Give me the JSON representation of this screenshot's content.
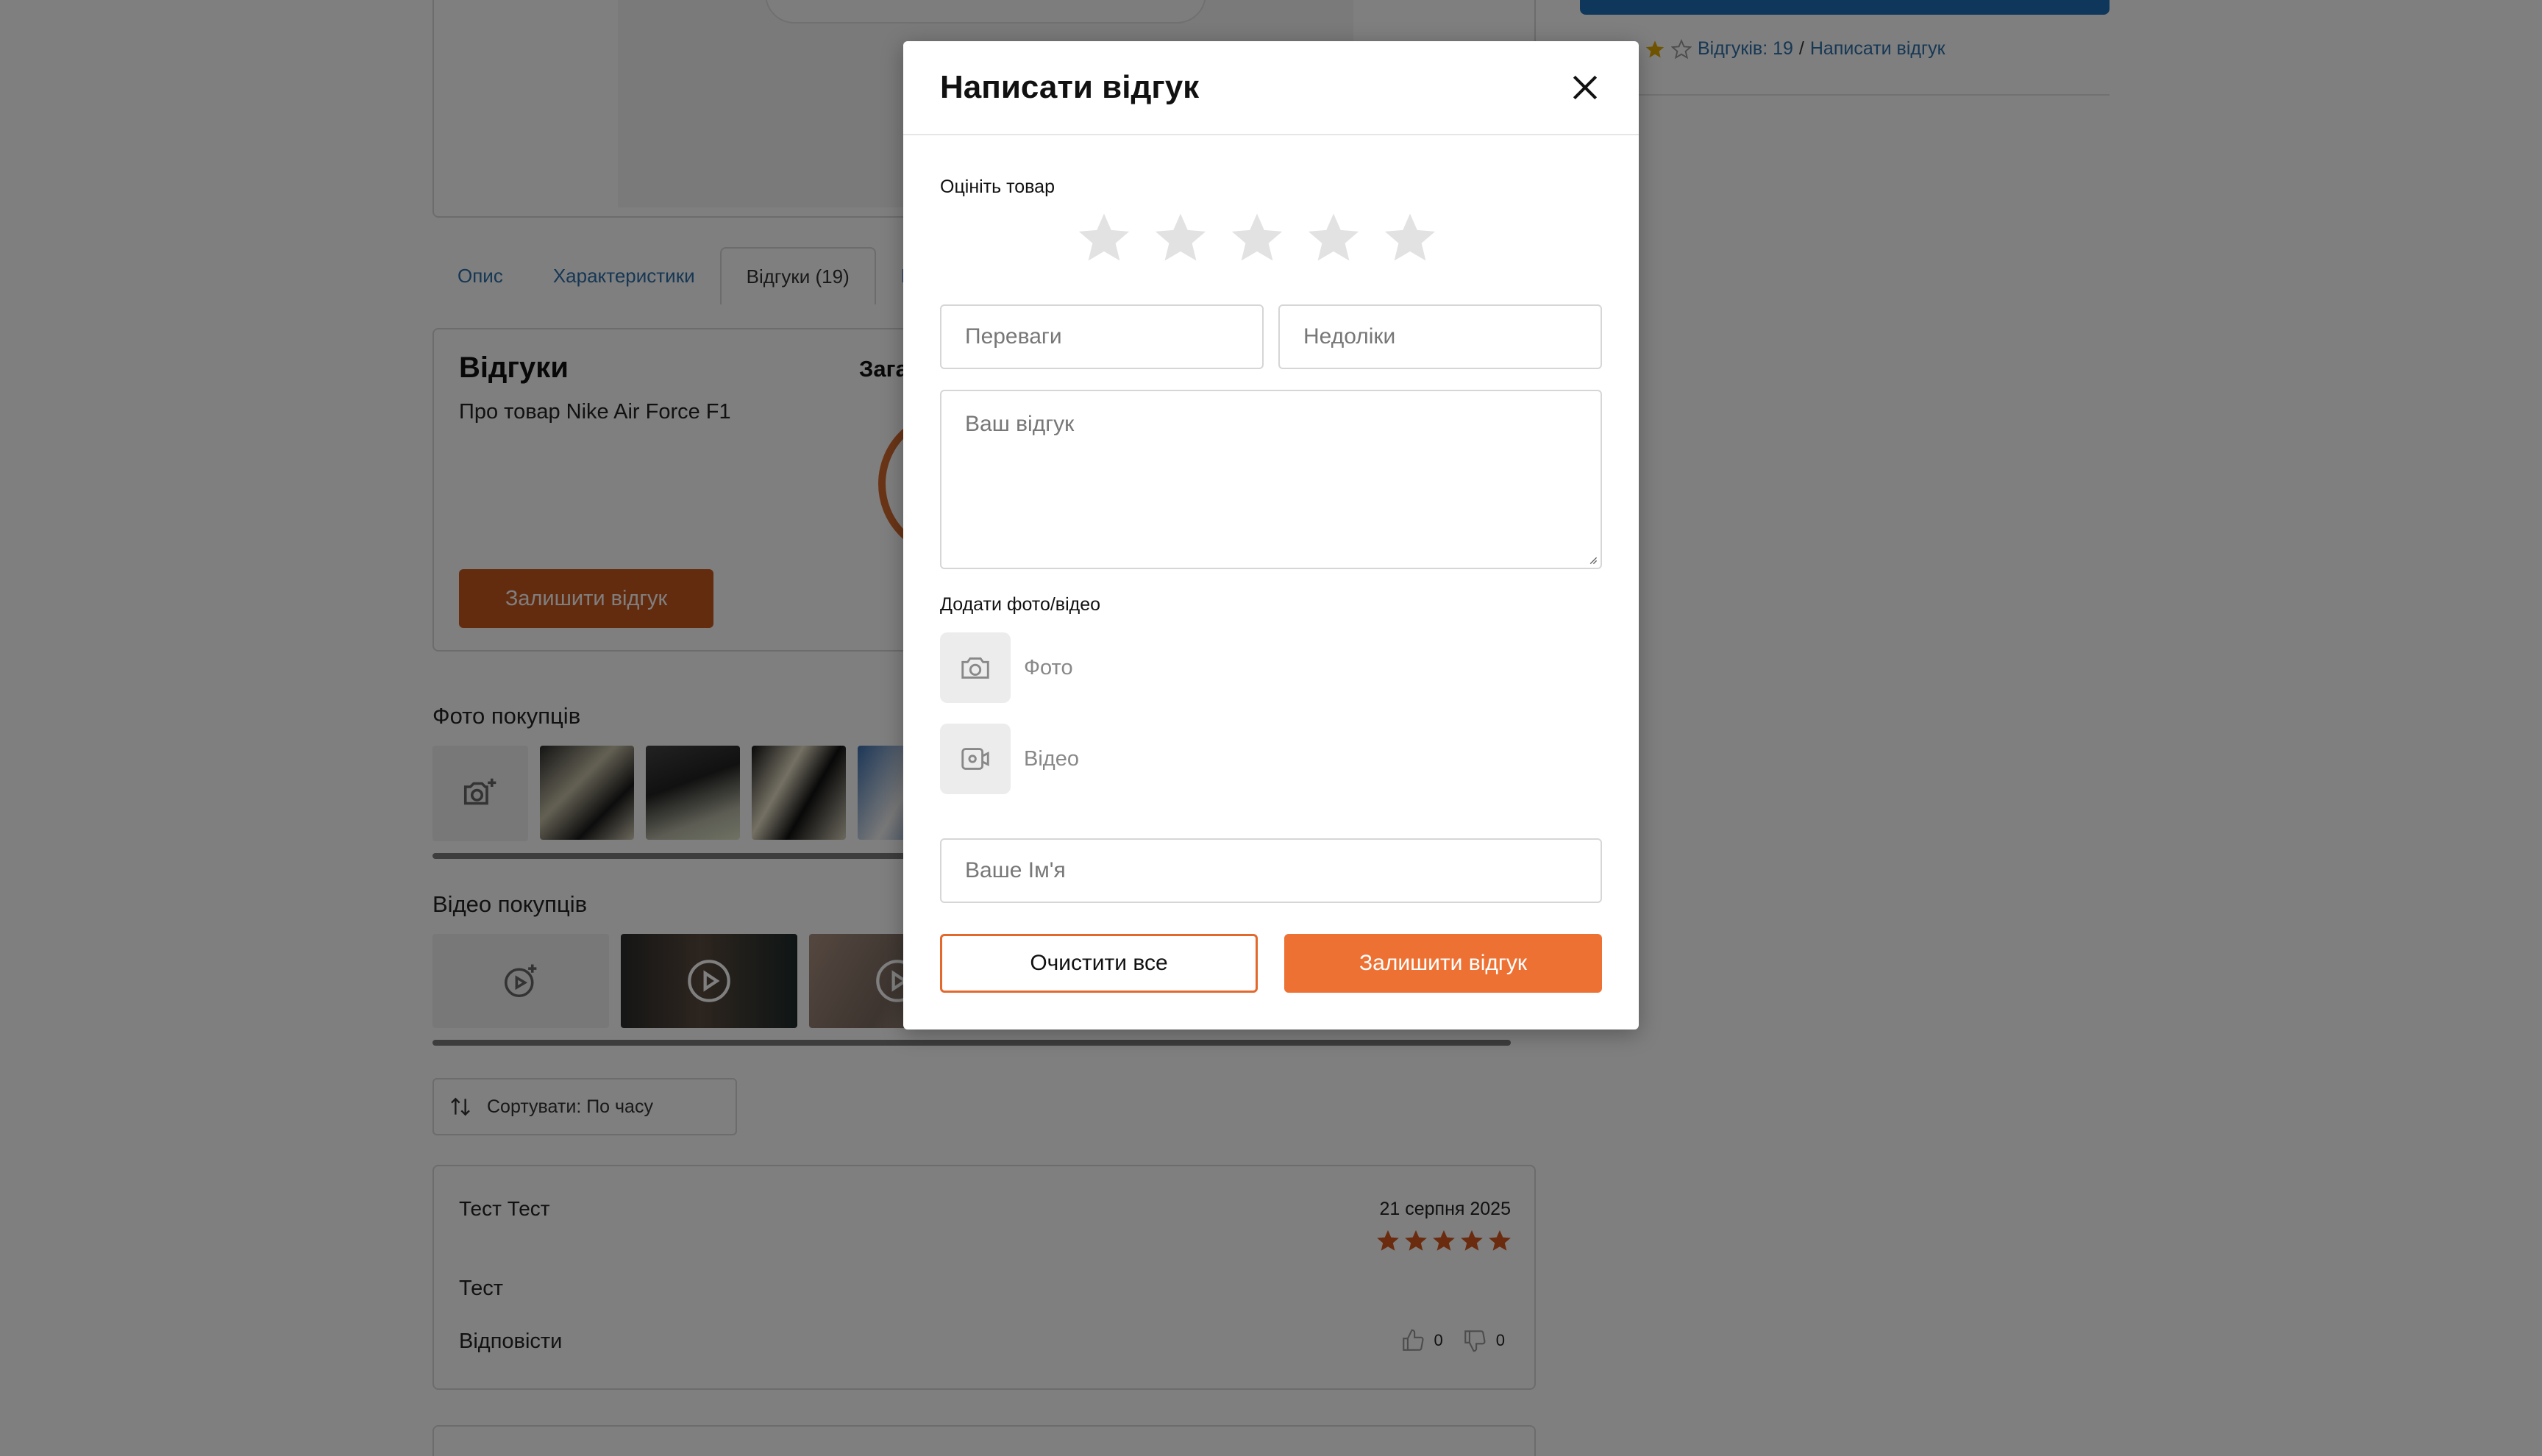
{
  "tabs": [
    {
      "label": "Опис"
    },
    {
      "label": "Характеристики"
    },
    {
      "label": "Відгуки (19)"
    },
    {
      "label": "П"
    }
  ],
  "reviews_box": {
    "title": "Відгуки",
    "subtitle": "Про товар Nike Air Force F1",
    "overall_label": "Зага",
    "leave_button": "Залишити відгук"
  },
  "photos": {
    "title": "Фото покупців"
  },
  "videos": {
    "title": "Відео покупців"
  },
  "sort": {
    "label": "Сортувати: По часу"
  },
  "review": {
    "author": "Тест Тест",
    "date": "21 серпня 2025",
    "stars": 5,
    "text": "Тест",
    "reply": "Відповісти",
    "likes": "0",
    "dislikes": "0"
  },
  "right_panel": {
    "reviews_link": "Відгуків: 19",
    "separator": "/",
    "write_link": "Написати відгук"
  },
  "modal": {
    "title": "Написати відгук",
    "rate_label": "Оцініть товар",
    "rating": 0,
    "pros_placeholder": "Переваги",
    "cons_placeholder": "Недоліки",
    "review_placeholder": "Ваш відгук",
    "media_label": "Додати фото/відео",
    "photo_label": "Фото",
    "video_label": "Відео",
    "name_placeholder": "Ваше Ім'я",
    "clear_button": "Очистити все",
    "submit_button": "Залишити відгук"
  },
  "colors": {
    "accent": "#ee7134",
    "accent_dark": "#c9591f",
    "link": "#2d6fa8",
    "star_empty": "#e2e2e2",
    "star_filled": "#d4561c"
  }
}
